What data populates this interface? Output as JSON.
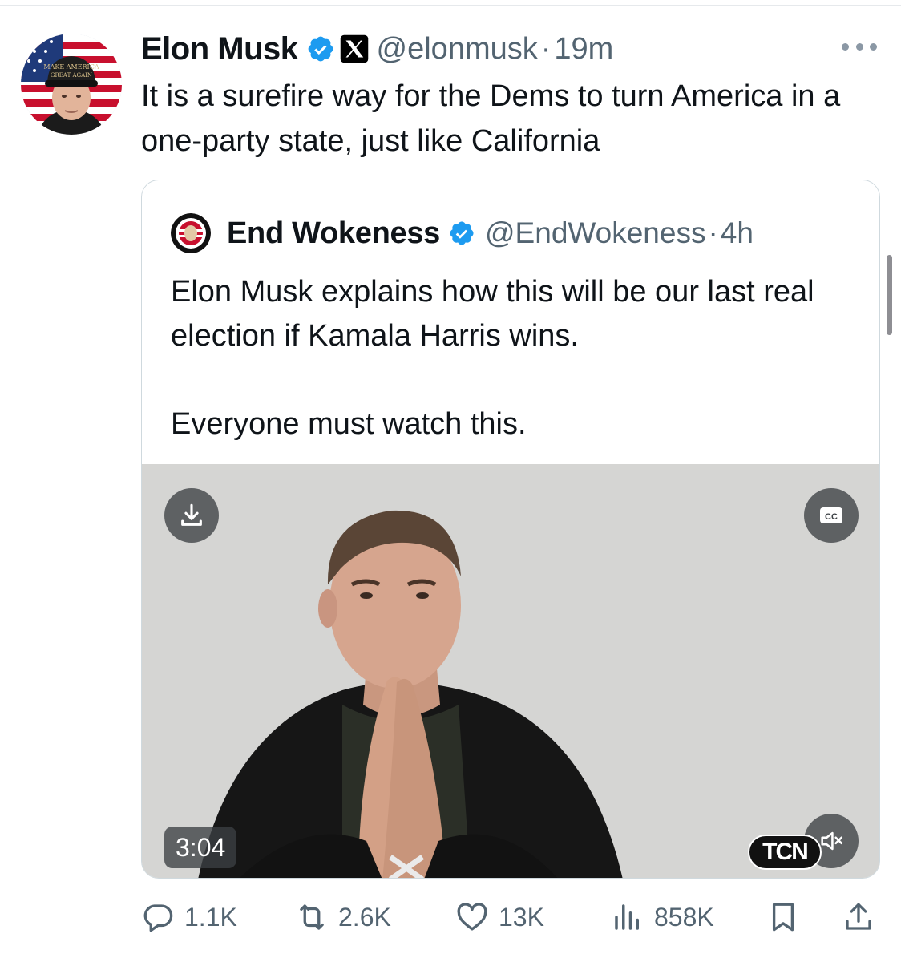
{
  "tweet": {
    "author": {
      "name": "Elon Musk",
      "handle": "@elonmusk",
      "time": "19m",
      "hat_text": "MAKE AMERICA GREAT AGAIN"
    },
    "text": "It is a surefire way for the Dems to turn America in a one-party state, just like California",
    "icons": {
      "verified": "verified-badge-icon",
      "affiliation": "x-logo-icon",
      "more": "more-options-icon"
    }
  },
  "quote": {
    "author": {
      "name": "End Wokeness",
      "handle": "@EndWokeness",
      "time": "4h"
    },
    "paragraphs": [
      "Elon Musk explains how this will be our last real election if Kamala Harris wins.",
      "Everyone must watch this."
    ],
    "video": {
      "duration": "3:04",
      "watermark": "TCN",
      "icons": [
        "download-icon",
        "closed-captions-icon",
        "mute-icon"
      ]
    }
  },
  "actions": {
    "replies": "1.1K",
    "reposts": "2.6K",
    "likes": "13K",
    "views": "858K"
  },
  "colors": {
    "accent": "#1d9bf0",
    "muted_text": "#536471",
    "text": "#0f1419",
    "border": "#cfd9de"
  }
}
